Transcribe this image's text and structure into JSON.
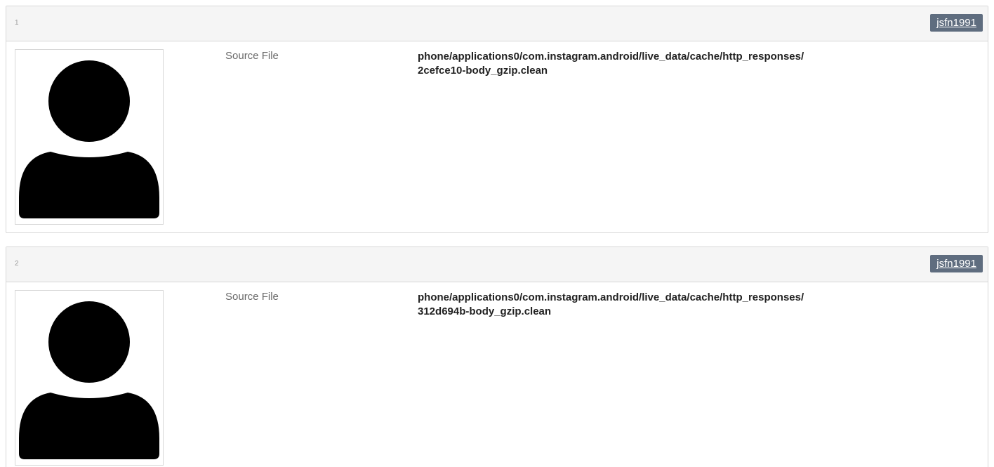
{
  "results": [
    {
      "index": "1",
      "user": "jsfn1991",
      "field_label": "Source File",
      "path_line1": "phone/applications0/com.instagram.android/live_data/cache/http_responses/",
      "path_line2": "2cefce10-body_gzip.clean"
    },
    {
      "index": "2",
      "user": "jsfn1991",
      "field_label": "Source File",
      "path_line1": "phone/applications0/com.instagram.android/live_data/cache/http_responses/",
      "path_line2": "312d694b-body_gzip.clean"
    }
  ],
  "icons": {
    "avatar": "user-silhouette-icon"
  }
}
